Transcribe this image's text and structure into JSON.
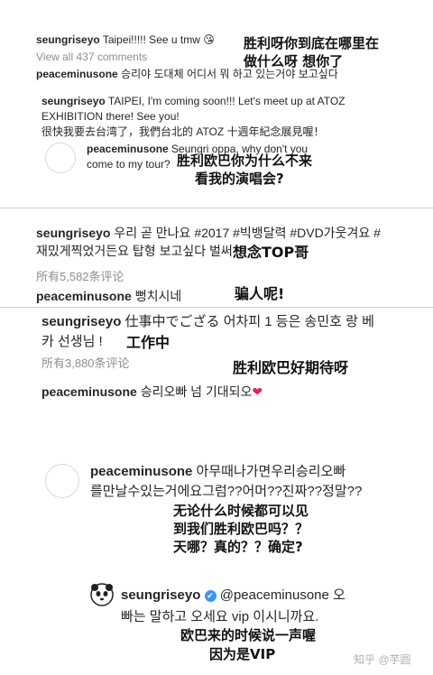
{
  "seg1": {
    "post_user": "seungriseyo",
    "post_text": "Taipei!!!!! See u tmw",
    "post_emoji": "😘",
    "view_all": "View all 437 comments",
    "comment_user": "peaceminusone",
    "comment_text": "승리야 도대체 어디서 뭐 하고 있는거야 보고싶다",
    "note1_line1": "胜利呀你到底在哪里在",
    "note1_line2": "做什么呀 想你了",
    "quote_user": "seungriseyo",
    "quote_line1": "TAIPEI, I'm coming soon!!! Let's meet up at ATOZ",
    "quote_line2": "EXHIBITION there! See you!",
    "quote_line3": "很快我要去台湾了，我們台北的 ATOZ 十週年紀念展見喔！",
    "reply_user": "peaceminusone",
    "reply_line1": "Seungri oppa, why don't you",
    "reply_line2": "come to my tour?",
    "note2_line1": "胜利欧巴你为什么不来",
    "note2_line2": "看我的演唱会?"
  },
  "seg2": {
    "user": "seungriseyo",
    "line1": "우리 곧 만나요 #2017 #빅뱅달력 #DVD가웃겨요 #",
    "line2": "재밌게찍었거든요 탑형 보고싶다 벌써",
    "note": "想念TOP哥",
    "count": "所有5,582条评论",
    "reply_user": "peaceminusone",
    "reply_text": "뻥치시네",
    "reply_note": "骗人呢!"
  },
  "seg3": {
    "user": "seungriseyo",
    "line1": "仕事中でござる 어차피 1 등은 송민호 랑 베",
    "line2": "카 선생님 !",
    "note_work": "工作中",
    "count": "所有3,880条评论",
    "note_wait": "胜利欧巴好期待呀",
    "reply_user": "peaceminusone",
    "reply_text": "승리오빠 넘 기대되오",
    "reply_heart": "❤"
  },
  "seg4": {
    "user": "peaceminusone",
    "line1": "아무때나가면우리승리오빠",
    "line2": "를만날수있는거에요그럼??어머??진짜??정말??",
    "note1": "无论什么时候都可以见",
    "note2": "到我们胜利欧巴吗？？",
    "note3": "天哪？真的？？确定?"
  },
  "seg5": {
    "user": "seungriseyo",
    "verified": "✔",
    "mention": "@peaceminusone 오",
    "line2": "빠는 말하고 오세요 vip 이시니까요.",
    "note1": "欧巴来的时候说一声喔",
    "note2": "因为是VIP",
    "watermark": "知乎 @芋圆"
  },
  "colors": {
    "heart": "#e0245e",
    "verified": "#3897f0",
    "separator": "#d0d0d0"
  }
}
